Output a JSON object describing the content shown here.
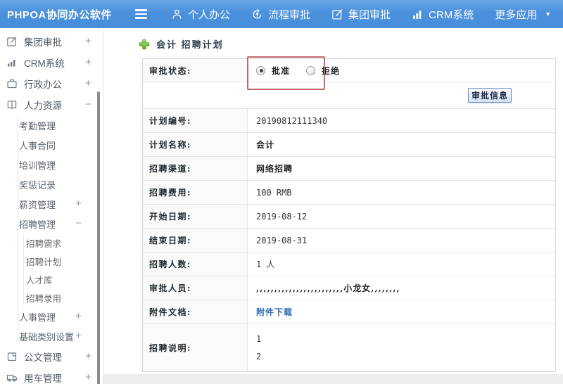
{
  "app": {
    "title": "PHPOA协同办公软件"
  },
  "topnav": {
    "items": [
      {
        "label": "个人办公",
        "icon": "user-icon"
      },
      {
        "label": "流程审批",
        "icon": "process-approval-icon"
      },
      {
        "label": "集团审批",
        "icon": "group-approval-icon"
      },
      {
        "label": "CRM系统",
        "icon": "crm-chart-icon"
      },
      {
        "label": "更多应用",
        "icon": "caret-down-icon"
      }
    ]
  },
  "sidebar": {
    "items": [
      {
        "label": "集团审批",
        "expand": "+",
        "icon": "edit-square-icon"
      },
      {
        "label": "CRM系统",
        "expand": "+",
        "icon": "bar-chart-icon"
      },
      {
        "label": "行政办公",
        "expand": "+",
        "icon": "briefcase-icon"
      },
      {
        "label": "人力资源",
        "expand": "−",
        "icon": "book-icon"
      },
      {
        "label": "考勤管理",
        "expand": ""
      },
      {
        "label": "人事合同",
        "expand": ""
      },
      {
        "label": "培训管理",
        "expand": ""
      },
      {
        "label": "奖惩记录",
        "expand": ""
      },
      {
        "label": "薪资管理",
        "expand": "+"
      },
      {
        "label": "招聘管理",
        "expand": "−"
      },
      {
        "label": "招聘需求",
        "expand": ""
      },
      {
        "label": "招聘计划",
        "expand": ""
      },
      {
        "label": "人才库",
        "expand": ""
      },
      {
        "label": "招聘录用",
        "expand": ""
      },
      {
        "label": "人事管理",
        "expand": "+"
      },
      {
        "label": "基础类别设置",
        "expand": "+"
      },
      {
        "label": "公文管理",
        "expand": "+",
        "icon": "document-icon"
      },
      {
        "label": "用车管理",
        "expand": "+",
        "icon": "truck-icon"
      }
    ]
  },
  "main": {
    "page_title": "会计 招聘计划",
    "approval": {
      "status_label": "审批状态:",
      "options": [
        {
          "label": "批准",
          "checked": true
        },
        {
          "label": "拒绝",
          "checked": false
        }
      ],
      "info_button_label": "审批信息"
    },
    "fields": [
      {
        "label": "计划编号:",
        "value": "20190812111340"
      },
      {
        "label": "计划名称:",
        "value": "会计"
      },
      {
        "label": "招聘渠道:",
        "value": "网络招聘"
      },
      {
        "label": "招聘费用:",
        "value": "100 RMB"
      },
      {
        "label": "开始日期:",
        "value": "2019-08-12"
      },
      {
        "label": "结束日期:",
        "value": "2019-08-31"
      },
      {
        "label": "招聘人数:",
        "value": "1 人"
      },
      {
        "label": "审批人员:",
        "value": ",,,,,,,,,,,,,,,,,,,,,,,,小龙女,,,,,,,,"
      },
      {
        "label": "附件文档:",
        "value": "附件下载"
      }
    ],
    "description": {
      "label": "招聘说明:",
      "lines": [
        "1",
        "2"
      ]
    }
  },
  "colors": {
    "topbar_blue": "#4a90dc",
    "link_blue": "#2e6db5",
    "highlight_red": "#c4686c",
    "plus_green": "#6fbe33",
    "button_border": "#7191c6"
  }
}
